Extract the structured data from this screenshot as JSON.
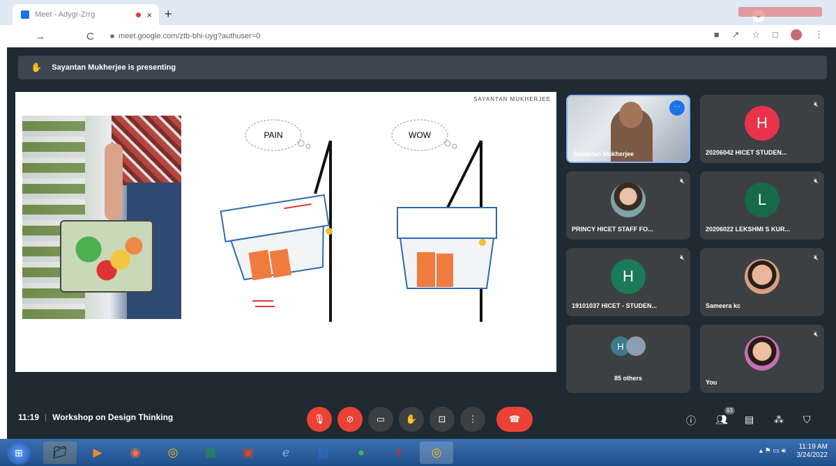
{
  "browser": {
    "tab_title": "Meet - Adygr-Zrrg",
    "close_label": "×",
    "newtab_label": "+",
    "url": "meet.google.com/ztb-bhi-uyg?authuser=0"
  },
  "banner": {
    "text": "Sayantan Mukherjee is presenting"
  },
  "slide": {
    "author": "SAYANTAN MUKHERJEE",
    "bubble_left": "PAIN",
    "bubble_right": "WOW"
  },
  "tiles": [
    {
      "name": "Sayantan Mukherjee",
      "type": "video"
    },
    {
      "name": "20206042 HICET STUDEN...",
      "letter": "H",
      "color": "#e8334a"
    },
    {
      "name": "PRINCY HICET STAFF FO...",
      "type": "photo",
      "color": "#7fa3a6"
    },
    {
      "name": "20206022 LEKSHMI S KUR...",
      "letter": "L",
      "color": "#166a4b"
    },
    {
      "name": "19101037 HICET - STUDEN...",
      "letter": "H",
      "color": "#1b7a58"
    },
    {
      "name": "Sameera kc",
      "type": "photo",
      "color": "#d7a07e"
    },
    {
      "name": "85 others",
      "type": "others",
      "letter": "H"
    },
    {
      "name": "You",
      "type": "photo",
      "color": "#c36fb5"
    }
  ],
  "bottombar": {
    "time": "11:19",
    "meeting_title": "Workshop on Design Thinking",
    "participants_count": "93"
  },
  "taskbar": {
    "time": "11:19 AM",
    "date": "3/24/2022"
  },
  "colors": {
    "meet_bg": "#1f2a33",
    "tile_bg": "#3c4043",
    "danger": "#ea4335",
    "accent": "#8ab4f8"
  }
}
